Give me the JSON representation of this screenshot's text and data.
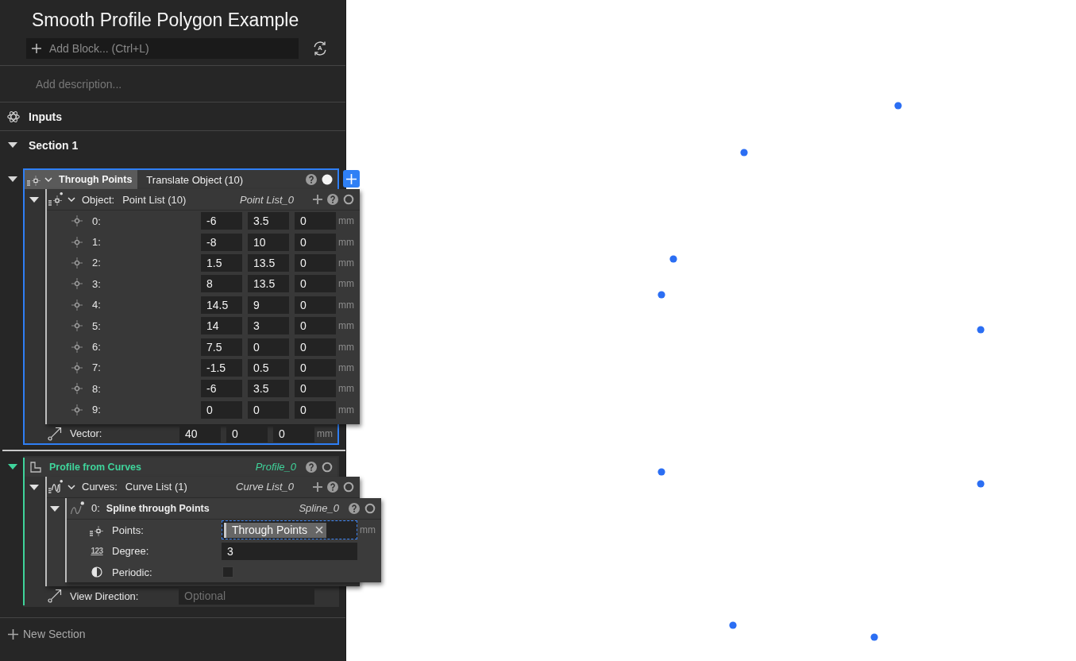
{
  "title": "Smooth Profile Polygon Example",
  "add_block": {
    "placeholder": "Add Block... (Ctrl+L)"
  },
  "auto_regenerate": {
    "glyph": "A"
  },
  "description": {
    "placeholder": "Add description..."
  },
  "inputs": {
    "label": "Inputs"
  },
  "sections": [
    {
      "title": "Section 1",
      "expanded": true,
      "blocks": [
        {
          "kind": "translate",
          "selected": true,
          "expanded": true,
          "visible": true,
          "name": "Through Points",
          "title": "Translate Object (10)",
          "params": [
            {
              "kind": "point_list",
              "label": "Object:",
              "value": "Point List (10)",
              "ref": "Point List_0",
              "expanded": true,
              "visible": false,
              "items": [
                {
                  "label": "0:",
                  "values": [
                    "-6",
                    "3.5",
                    "0"
                  ],
                  "unit": "mm"
                },
                {
                  "label": "1:",
                  "values": [
                    "-8",
                    "10",
                    "0"
                  ],
                  "unit": "mm"
                },
                {
                  "label": "2:",
                  "values": [
                    "1.5",
                    "13.5",
                    "0"
                  ],
                  "unit": "mm"
                },
                {
                  "label": "3:",
                  "values": [
                    "8",
                    "13.5",
                    "0"
                  ],
                  "unit": "mm"
                },
                {
                  "label": "4:",
                  "values": [
                    "14.5",
                    "9",
                    "0"
                  ],
                  "unit": "mm"
                },
                {
                  "label": "5:",
                  "values": [
                    "14",
                    "3",
                    "0"
                  ],
                  "unit": "mm"
                },
                {
                  "label": "6:",
                  "values": [
                    "7.5",
                    "0",
                    "0"
                  ],
                  "unit": "mm"
                },
                {
                  "label": "7:",
                  "values": [
                    "-1.5",
                    "0.5",
                    "0"
                  ],
                  "unit": "mm"
                },
                {
                  "label": "8:",
                  "values": [
                    "-6",
                    "3.5",
                    "0"
                  ],
                  "unit": "mm"
                },
                {
                  "label": "9:",
                  "values": [
                    "0",
                    "0",
                    "0"
                  ],
                  "unit": "mm"
                }
              ]
            },
            {
              "kind": "vector",
              "label": "Vector:",
              "values": [
                "40",
                "0",
                "0"
              ],
              "unit": "mm"
            }
          ]
        },
        {
          "kind": "profile",
          "selected": false,
          "expanded": true,
          "visible": false,
          "color": "#3fd49b",
          "title": "Profile from Curves",
          "ref": "Profile_0",
          "params": [
            {
              "kind": "curve_list",
              "label": "Curves:",
              "value": "Curve List (1)",
              "ref": "Curve List_0",
              "expanded": true,
              "visible": false,
              "items": [
                {
                  "label": "0:",
                  "title": "Spline through Points",
                  "ref": "Spline_0",
                  "expanded": true,
                  "visible": false,
                  "params": [
                    {
                      "kind": "reference",
                      "label": "Points:",
                      "chips": [
                        "Through Points"
                      ],
                      "unit": "mm",
                      "focused": true
                    },
                    {
                      "kind": "number",
                      "glyph": "123",
                      "label": "Degree:",
                      "value": "3"
                    },
                    {
                      "kind": "checkbox",
                      "label": "Periodic:",
                      "checked": false
                    }
                  ]
                }
              ]
            },
            {
              "kind": "vector",
              "label": "View Direction:",
              "placeholder": "Optional"
            }
          ]
        }
      ]
    }
  ],
  "new_section": {
    "label": "New Section"
  }
}
